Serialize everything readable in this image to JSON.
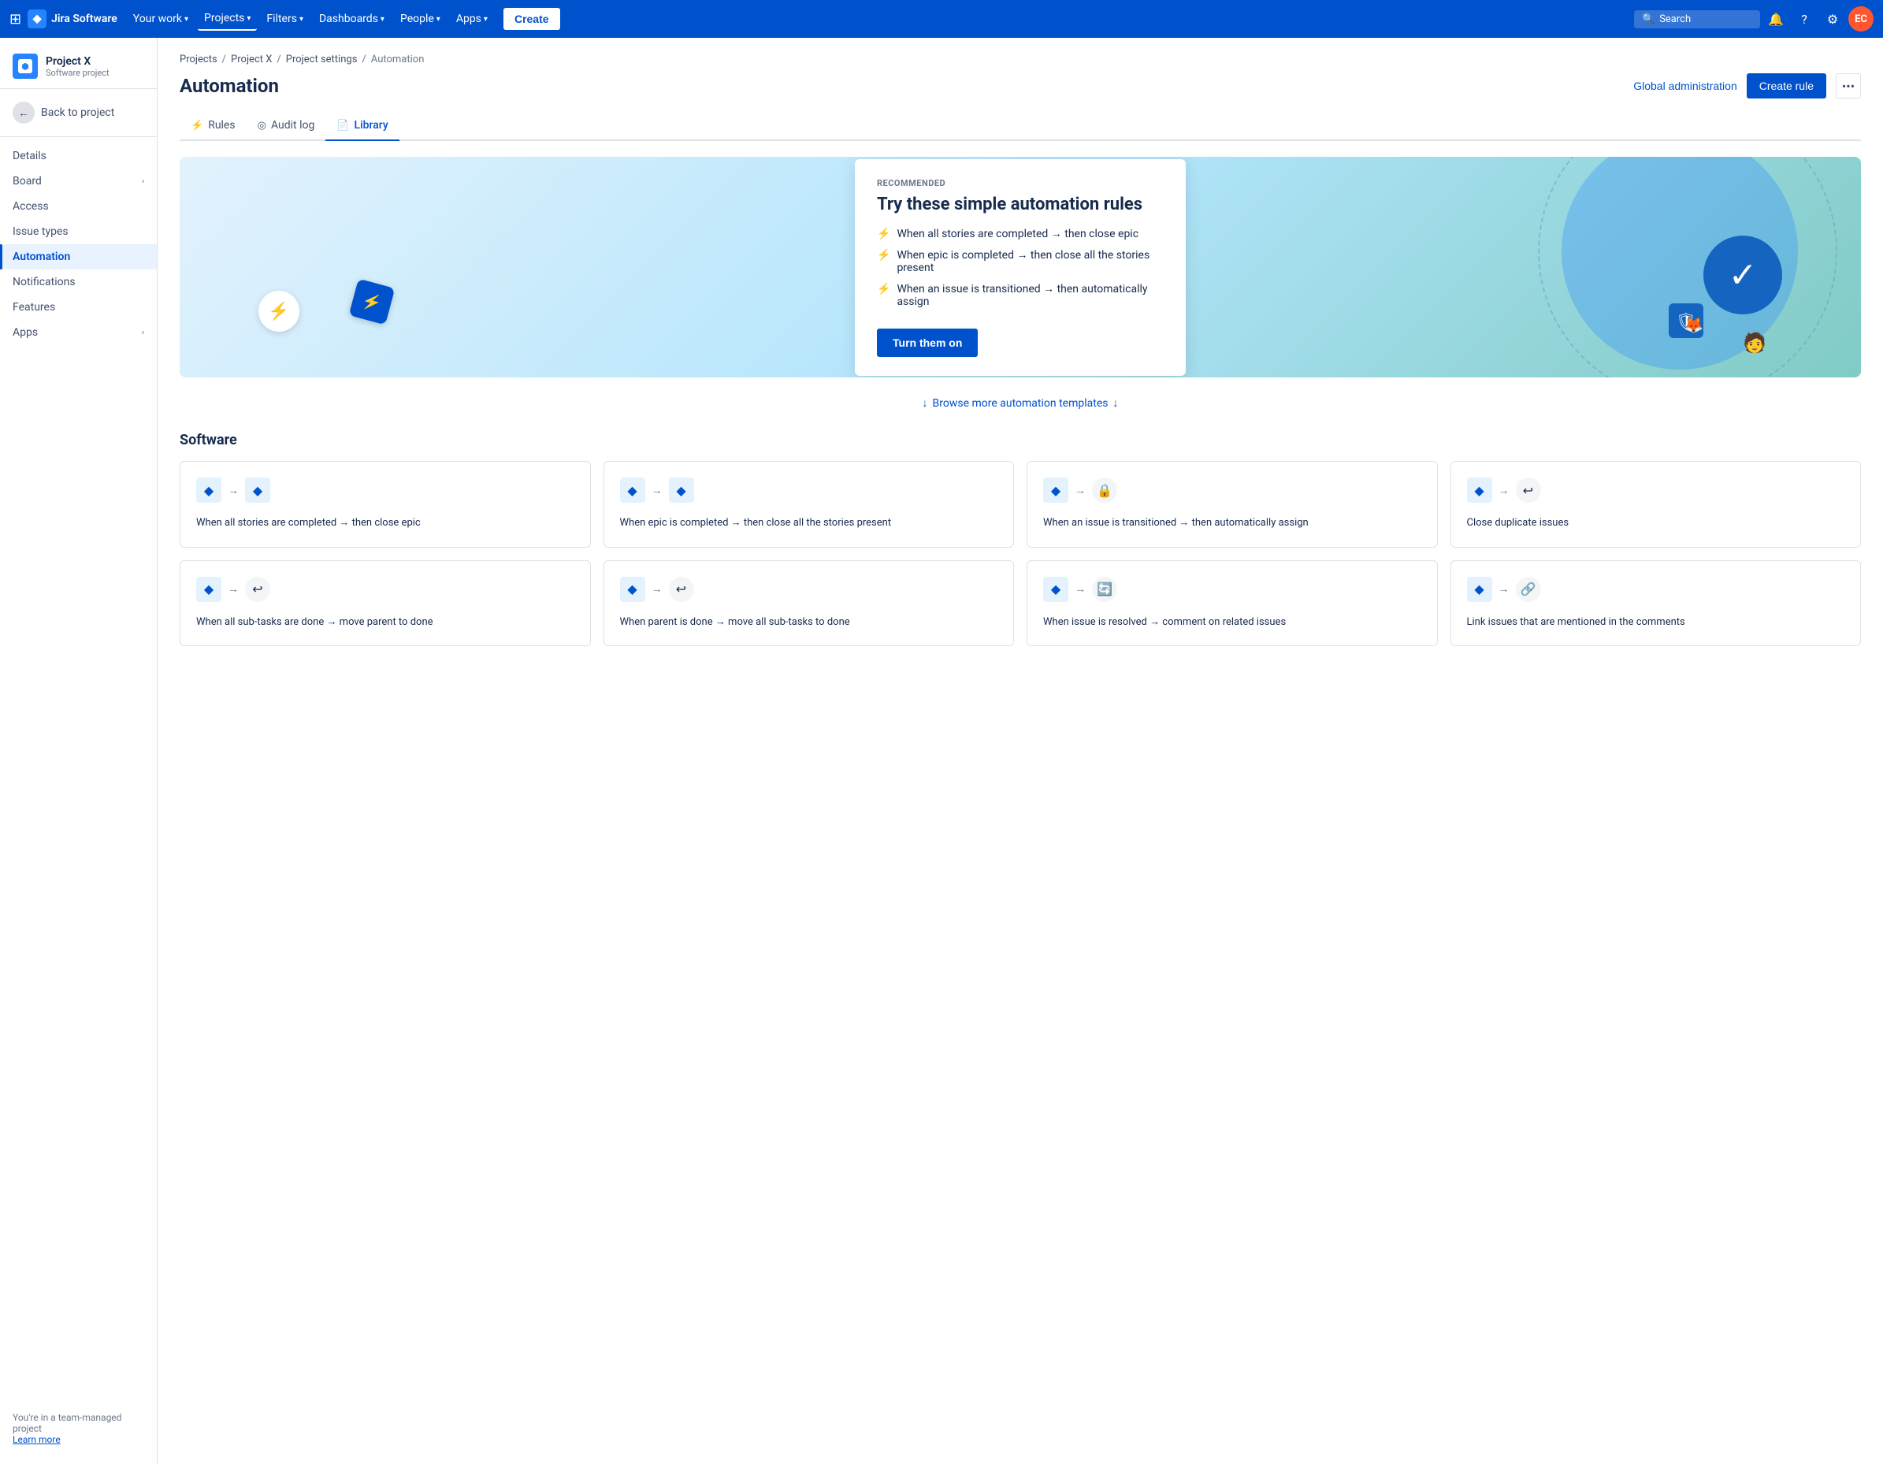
{
  "topnav": {
    "logo_text": "Jira Software",
    "links": [
      "Your work",
      "Projects",
      "Filters",
      "Dashboards",
      "People",
      "Apps"
    ],
    "search_placeholder": "Search",
    "create_label": "Create",
    "avatar_initials": "EC"
  },
  "sidebar": {
    "project_name": "Project X",
    "project_type": "Software project",
    "back_label": "Back to project",
    "items": [
      {
        "label": "Details",
        "active": false
      },
      {
        "label": "Board",
        "active": false,
        "expandable": true
      },
      {
        "label": "Access",
        "active": false
      },
      {
        "label": "Issue types",
        "active": false
      },
      {
        "label": "Automation",
        "active": true
      },
      {
        "label": "Notifications",
        "active": false
      },
      {
        "label": "Features",
        "active": false
      },
      {
        "label": "Apps",
        "active": false,
        "expandable": true
      }
    ],
    "footer_text": "You're in a team-managed project",
    "footer_link": "Learn more"
  },
  "breadcrumb": {
    "items": [
      "Projects",
      "Project X",
      "Project settings",
      "Automation"
    ]
  },
  "page": {
    "title": "Automation",
    "global_admin_label": "Global administration",
    "create_rule_label": "Create rule",
    "more_label": "•••"
  },
  "tabs": [
    {
      "label": "Rules",
      "icon": "⚡",
      "active": false
    },
    {
      "label": "Audit log",
      "icon": "◎",
      "active": false
    },
    {
      "label": "Library",
      "icon": "📄",
      "active": true
    }
  ],
  "hero": {
    "recommended_label": "RECOMMENDED",
    "title": "Try these simple automation rules",
    "rules": [
      "When all stories are completed → then close epic",
      "When epic is completed → then close all the stories present",
      "When an issue is transitioned → then automatically assign"
    ],
    "cta_label": "Turn them on"
  },
  "browse_more": {
    "label": "Browse more automation templates"
  },
  "software_section": {
    "title": "Software",
    "cards": [
      {
        "text": "When all stories are completed → then close epic",
        "trigger_icon": "diamond",
        "target_icon": "diamond"
      },
      {
        "text": "When epic is completed → then close all the stories present",
        "trigger_icon": "diamond",
        "target_icon": "diamond"
      },
      {
        "text": "When an issue is transitioned → then automatically assign",
        "trigger_icon": "diamond",
        "target_icon": "lock"
      },
      {
        "text": "Close duplicate issues",
        "trigger_icon": "diamond",
        "target_icon": "loop"
      },
      {
        "text": "When all sub-tasks are done → move parent to done",
        "trigger_icon": "diamond",
        "target_icon": "loop"
      },
      {
        "text": "When parent is done → move all sub-tasks to done",
        "trigger_icon": "diamond",
        "target_icon": "loop"
      },
      {
        "text": "When issue is resolved → comment on related issues",
        "trigger_icon": "diamond",
        "target_icon": "refresh"
      },
      {
        "text": "Link issues that are mentioned in the comments",
        "trigger_icon": "diamond",
        "target_icon": "link"
      }
    ]
  }
}
